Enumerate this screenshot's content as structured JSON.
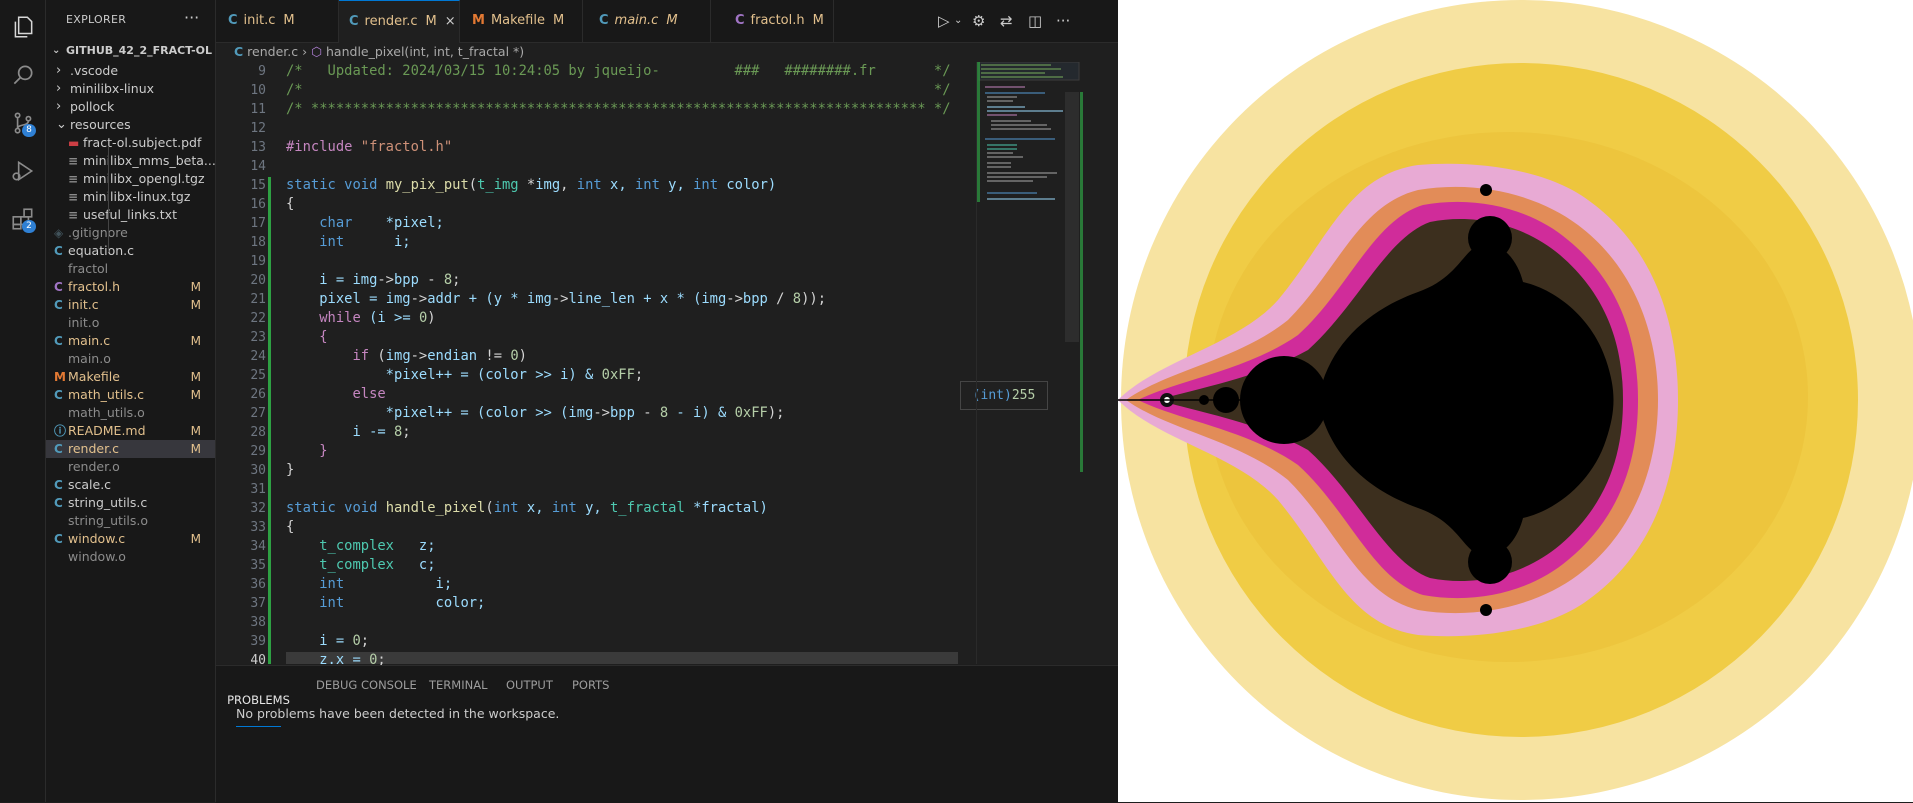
{
  "activity_bar": {
    "scm_badge": "8",
    "extensions_badge": "2"
  },
  "explorer": {
    "title": "EXPLORER",
    "more": "···",
    "root": "GITHUB_42_2_FRACT-OL",
    "items": [
      {
        "label": ".vscode",
        "kind": "folder",
        "status": ""
      },
      {
        "label": "minilibx-linux",
        "kind": "folder",
        "status": ""
      },
      {
        "label": "pollock",
        "kind": "folder",
        "status": ""
      },
      {
        "label": "resources",
        "kind": "folder-open",
        "status": ""
      },
      {
        "label": "fract-ol.subject.pdf",
        "kind": "pdf",
        "status": ""
      },
      {
        "label": "minilibx_mms_beta...",
        "kind": "file",
        "status": ""
      },
      {
        "label": "minilibx_opengl.tgz",
        "kind": "file",
        "status": ""
      },
      {
        "label": "minilibx-linux.tgz",
        "kind": "file",
        "status": ""
      },
      {
        "label": "useful_links.txt",
        "kind": "file",
        "status": ""
      },
      {
        "label": ".gitignore",
        "kind": "git",
        "status": ""
      },
      {
        "label": "equation.c",
        "kind": "c",
        "status": ""
      },
      {
        "label": "fractol",
        "kind": "plain",
        "status": ""
      },
      {
        "label": "fractol.h",
        "kind": "h",
        "status": "M"
      },
      {
        "label": "init.c",
        "kind": "c",
        "status": "M"
      },
      {
        "label": "init.o",
        "kind": "plain",
        "status": ""
      },
      {
        "label": "main.c",
        "kind": "c",
        "status": "M"
      },
      {
        "label": "main.o",
        "kind": "plain",
        "status": ""
      },
      {
        "label": "Makefile",
        "kind": "make",
        "status": "M"
      },
      {
        "label": "math_utils.c",
        "kind": "c",
        "status": "M"
      },
      {
        "label": "math_utils.o",
        "kind": "plain",
        "status": ""
      },
      {
        "label": "README.md",
        "kind": "info",
        "status": "M"
      },
      {
        "label": "render.c",
        "kind": "c",
        "status": "M"
      },
      {
        "label": "render.o",
        "kind": "plain",
        "status": ""
      },
      {
        "label": "scale.c",
        "kind": "c",
        "status": ""
      },
      {
        "label": "string_utils.c",
        "kind": "c",
        "status": ""
      },
      {
        "label": "string_utils.o",
        "kind": "plain",
        "status": ""
      },
      {
        "label": "window.c",
        "kind": "c",
        "status": "M"
      },
      {
        "label": "window.o",
        "kind": "plain",
        "status": ""
      }
    ]
  },
  "tabs": [
    {
      "label": "init.c",
      "icon": "C",
      "status": "M",
      "italic": false
    },
    {
      "label": "render.c",
      "icon": "C",
      "status": "M",
      "italic": false,
      "active": true,
      "close": "×"
    },
    {
      "label": "Makefile",
      "icon": "M",
      "status": "M",
      "italic": false
    },
    {
      "label": "main.c",
      "icon": "C",
      "status": "M",
      "italic": true
    },
    {
      "label": "fractol.h",
      "icon": "C",
      "status": "M",
      "italic": false
    }
  ],
  "breadcrumb": {
    "file": "render.c",
    "symbol": "handle_pixel(int, int, t_fractal *)"
  },
  "line_numbers": [
    "9",
    "10",
    "11",
    "12",
    "13",
    "14",
    "15",
    "16",
    "17",
    "18",
    "19",
    "20",
    "21",
    "22",
    "23",
    "24",
    "25",
    "26",
    "27",
    "28",
    "29",
    "30",
    "31",
    "32",
    "33",
    "34",
    "35",
    "36",
    "37",
    "38",
    "39",
    "40"
  ],
  "code": {
    "l9": "/*   Updated: 2024/03/15 10:24:05 by jqueijo-         ###   ########.fr       */",
    "l10": "/*                                                                            */",
    "l11": "/* ************************************************************************** */",
    "l13a": "#include ",
    "l13b": "\"fractol.h\"",
    "l15": [
      "static",
      " void ",
      "my_pix_put",
      "(",
      "t_img",
      " *",
      "img",
      ", ",
      "int",
      " x, ",
      "int",
      " y, ",
      "int",
      " color)"
    ],
    "l16": "{",
    "l17": [
      "    char",
      "    *pixel;"
    ],
    "l18": [
      "    int",
      "      i;"
    ],
    "l20": [
      "    i = ",
      "img",
      "->",
      "bpp",
      " - ",
      "8",
      ";"
    ],
    "l21": [
      "    pixel = ",
      "img",
      "->",
      "addr",
      " + (y * ",
      "img",
      "->",
      "line_len",
      " + x * (",
      "img",
      "->",
      "bpp",
      " / ",
      "8",
      "));"
    ],
    "l22": [
      "    ",
      "while",
      " (i >= ",
      "0",
      ")"
    ],
    "l23": "    {",
    "l24": [
      "        ",
      "if",
      " (",
      "img",
      "->",
      "endian",
      " != ",
      "0",
      ")"
    ],
    "l25": [
      "            *pixel++ = (color >> i) & ",
      "0xFF",
      ";"
    ],
    "l26": [
      "        ",
      "else"
    ],
    "l27": [
      "            *pixel++ = (color >> (",
      "img",
      "->",
      "bpp",
      " - ",
      "8",
      " - i) & ",
      "0xFF",
      ");"
    ],
    "l28": [
      "        i -= ",
      "8",
      ";"
    ],
    "l29": "    }",
    "l30": "}",
    "l32": [
      "static",
      " void ",
      "handle_pixel",
      "(",
      "int",
      " x, ",
      "int",
      " y, ",
      "t_fractal",
      " *fractal)"
    ],
    "l33": "{",
    "l34": [
      "    ",
      "t_complex",
      "   z;"
    ],
    "l35": [
      "    ",
      "t_complex",
      "   c;"
    ],
    "l36": [
      "    ",
      "int",
      "           i;"
    ],
    "l37": [
      "    ",
      "int",
      "           color;"
    ],
    "l39": [
      "    i = ",
      "0",
      ";"
    ],
    "l40": [
      "    z.x = ",
      "0",
      ";"
    ]
  },
  "hover": "(int)255",
  "panel": {
    "tabs": [
      "PROBLEMS",
      "DEBUG CONSOLE",
      "TERMINAL",
      "OUTPUT",
      "PORTS"
    ],
    "message": "No problems have been detected in the workspace."
  },
  "colors": {
    "accent": "#0078d4",
    "modified": "#e2c08d",
    "fractal_outer": "#f7e3a1",
    "fractal_mid": "#f0cc45",
    "fractal_pink": "#e8aad4",
    "fractal_orange": "#e28c58",
    "fractal_magenta": "#d02c9a"
  }
}
